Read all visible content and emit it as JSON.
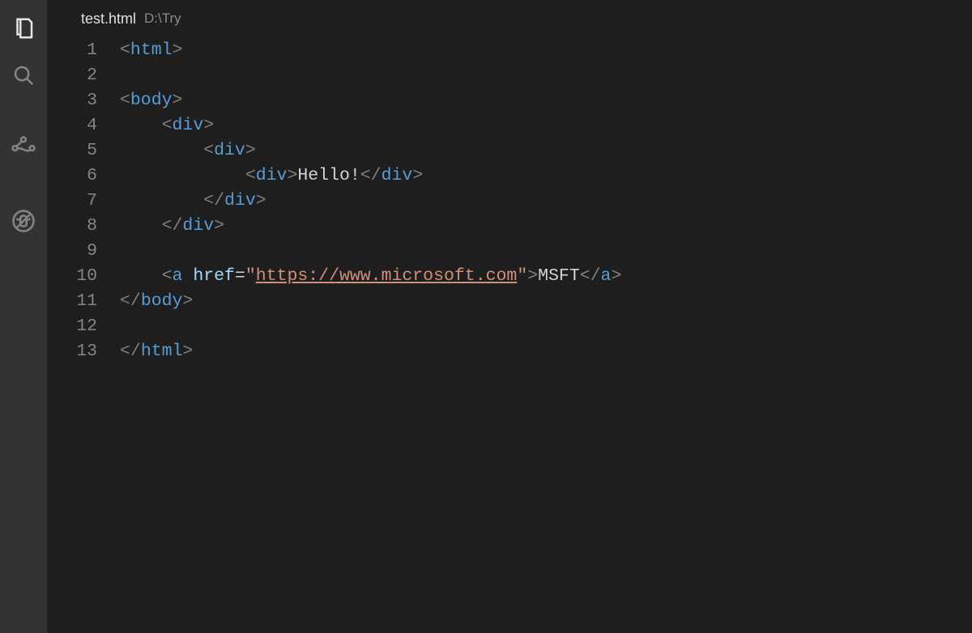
{
  "tab": {
    "filename": "test.html",
    "path": "D:\\Try"
  },
  "activity": {
    "explorer": "explorer",
    "search": "search",
    "scm": "source-control",
    "debug": "debug"
  },
  "lines": {
    "l1": {
      "no": "1",
      "punct1": "<",
      "tag": "html",
      "punct2": ">"
    },
    "l2": {
      "no": "2"
    },
    "l3": {
      "no": "3",
      "punct1": "<",
      "tag": "body",
      "punct2": ">"
    },
    "l4": {
      "no": "4",
      "punct1": "<",
      "tag": "div",
      "punct2": ">"
    },
    "l5": {
      "no": "5",
      "punct1": "<",
      "tag": "div",
      "punct2": ">"
    },
    "l6": {
      "no": "6",
      "punct1": "<",
      "tag1": "div",
      "punct2": ">",
      "text": "Hello!",
      "punct3": "</",
      "tag2": "div",
      "punct4": ">"
    },
    "l7": {
      "no": "7",
      "punct1": "</",
      "tag": "div",
      "punct2": ">"
    },
    "l8": {
      "no": "8",
      "punct1": "</",
      "tag": "div",
      "punct2": ">"
    },
    "l9": {
      "no": "9"
    },
    "l10": {
      "no": "10",
      "punct1": "<",
      "tag1": "a",
      "attr": "href",
      "op": "=",
      "q1": "\"",
      "href": "https://www.microsoft.com",
      "q2": "\"",
      "punct2": ">",
      "text": "MSFT",
      "punct3": "</",
      "tag2": "a",
      "punct4": ">"
    },
    "l11": {
      "no": "11",
      "punct1": "</",
      "tag": "body",
      "punct2": ">"
    },
    "l12": {
      "no": "12"
    },
    "l13": {
      "no": "13",
      "punct1": "</",
      "tag": "html",
      "punct2": ">"
    }
  }
}
